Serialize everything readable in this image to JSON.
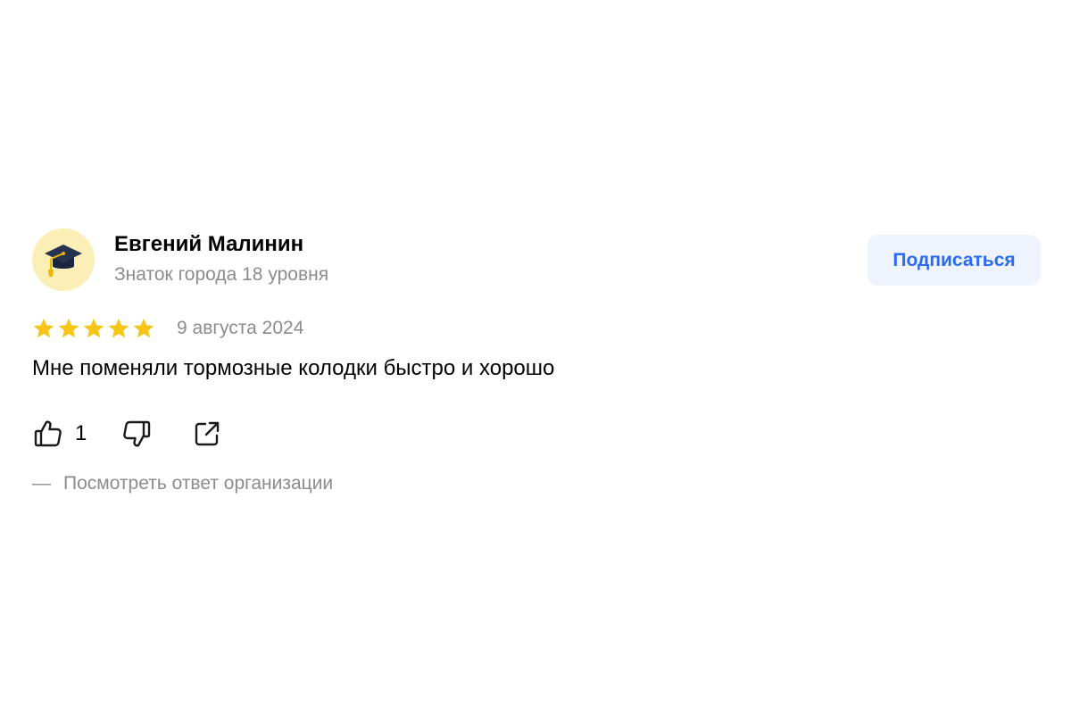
{
  "review": {
    "author_name": "Евгений Малинин",
    "author_level": "Знаток города 18 уровня",
    "subscribe_label": "Подписаться",
    "rating": 5,
    "rating_max": 5,
    "date": "9 августа 2024",
    "text": "Мне поменяли тормозные колодки быстро и хорошо",
    "likes": "1",
    "org_reply_dash": "—",
    "org_reply_label": "Посмотреть ответ организации"
  },
  "colors": {
    "accent": "#2b6bf3",
    "star": "#f5c518",
    "muted": "#8c8c8c",
    "avatar_bg": "#fbeeb6"
  },
  "icons": {
    "avatar": "graduation-cap-icon",
    "like": "thumbs-up-icon",
    "dislike": "thumbs-down-icon",
    "share": "share-icon",
    "star": "star-icon"
  }
}
